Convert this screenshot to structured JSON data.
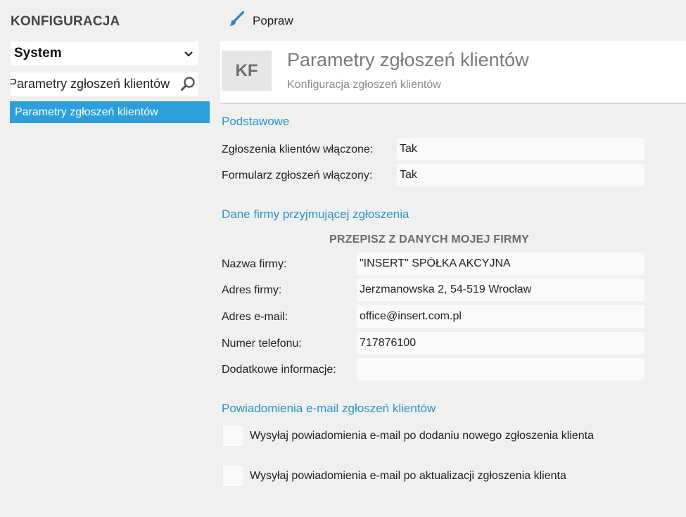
{
  "sidebar": {
    "title": "KONFIGURACJA",
    "select_value": "System",
    "search_value": "Parametry zgłoszeń klientów",
    "items": [
      {
        "label": "Parametry zgłoszeń klientów"
      }
    ]
  },
  "toolbar": {
    "edit_label": "Popraw",
    "edit_icon": "brush-icon"
  },
  "header": {
    "badge": "KF",
    "title": "Parametry zgłoszeń klientów",
    "subtitle": "Konfiguracja zgłoszeń klientów"
  },
  "basic": {
    "heading": "Podstawowe",
    "rows": [
      {
        "label": "Zgłoszenia klientów włączone:",
        "value": "Tak"
      },
      {
        "label": "Formularz zgłoszeń włączony:",
        "value": "Tak"
      }
    ]
  },
  "company": {
    "heading": "Dane firmy przyjmującej zgłoszenia",
    "copy_button": "PRZEPISZ Z DANYCH MOJEJ FIRMY",
    "rows": [
      {
        "label": "Nazwa firmy:",
        "value": "\"INSERT\" SPÓŁKA AKCYJNA"
      },
      {
        "label": "Adres firmy:",
        "value": "Jerzmanowska 2, 54-519 Wrocław"
      },
      {
        "label": "Adres e-mail:",
        "value": "office@insert.com.pl"
      },
      {
        "label": "Numer telefonu:",
        "value": "717876100"
      },
      {
        "label": "Dodatkowe informacje:",
        "value": ""
      }
    ]
  },
  "notifications": {
    "heading": "Powiadomienia e-mail zgłoszeń klientów",
    "options": [
      {
        "label": "Wysyłaj powiadomienia e-mail po dodaniu nowego zgłoszenia klienta",
        "checked": false
      },
      {
        "label": "Wysyłaj powiadomienia e-mail po aktualizacji zgłoszenia klienta",
        "checked": false
      }
    ]
  },
  "colors": {
    "accent": "#2d9fd8",
    "heading": "#2a93c6"
  }
}
